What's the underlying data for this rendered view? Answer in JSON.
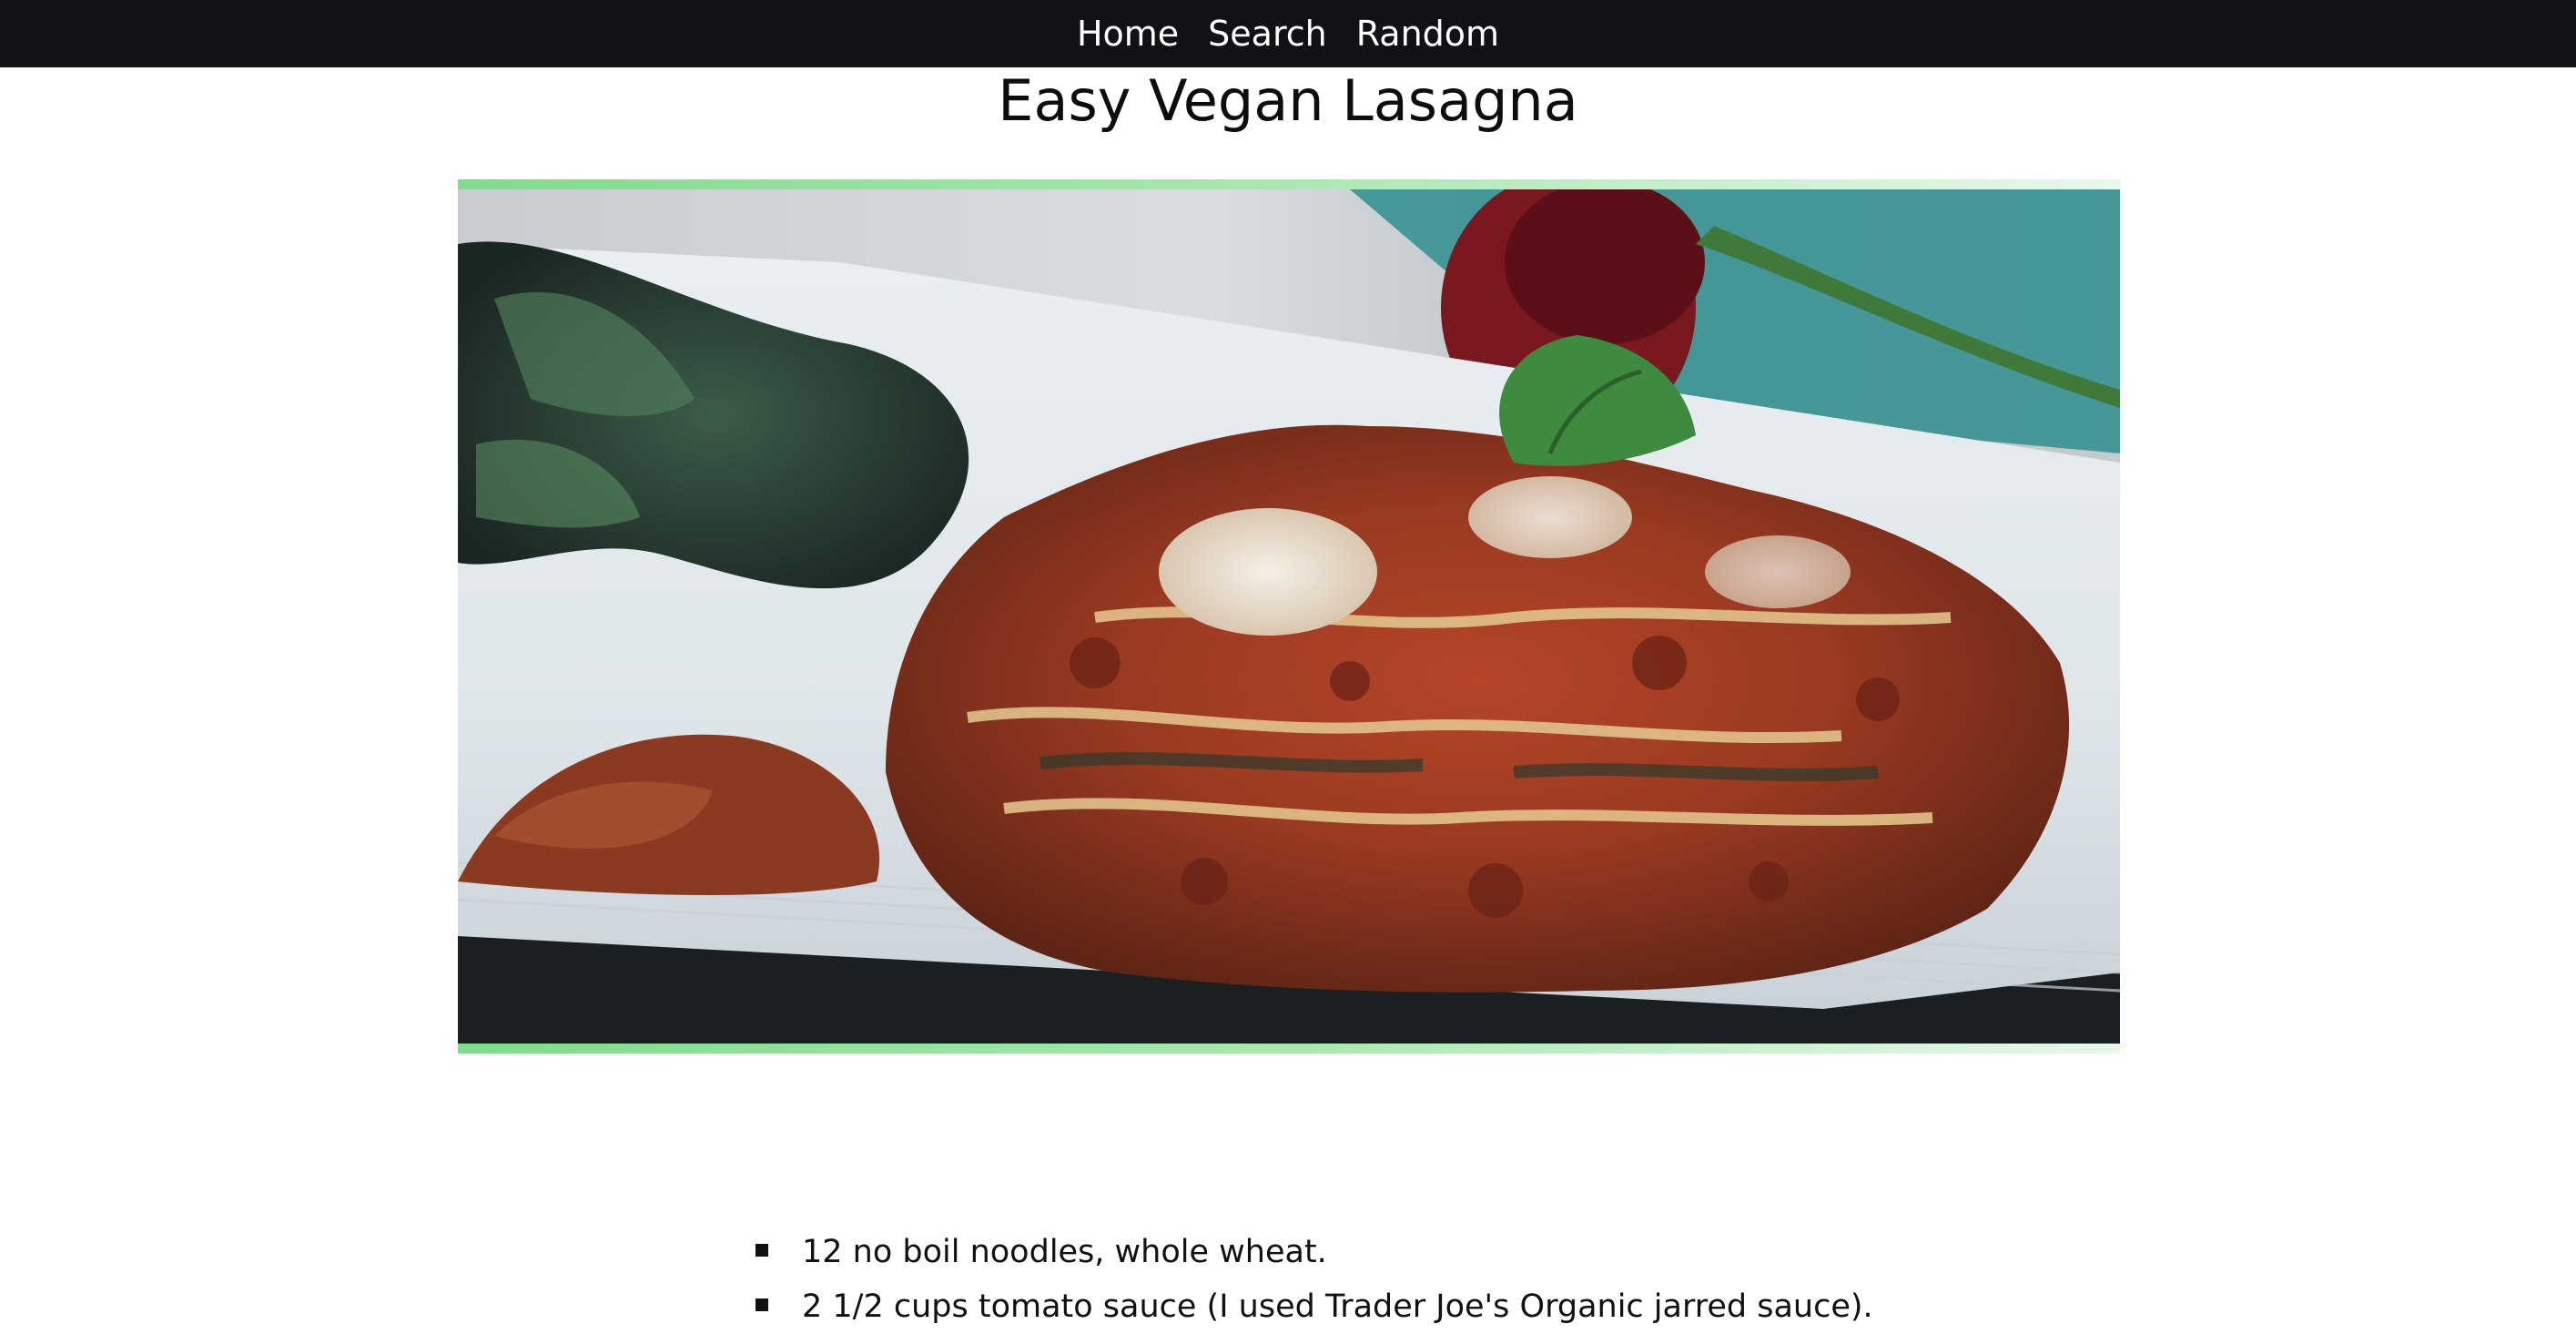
{
  "nav": {
    "links": [
      {
        "label": "Home"
      },
      {
        "label": "Search"
      },
      {
        "label": "Random"
      }
    ],
    "background_color": "#101216",
    "text_color": "#ffffff"
  },
  "recipe": {
    "title": "Easy Vegan Lasagna",
    "image": {
      "subject": "lasagna-photo",
      "frame_accent_color": "#7fdc8c"
    },
    "ingredients": [
      "12 no boil noodles, whole wheat.",
      "2 1/2 cups tomato sauce (I used Trader Joe's Organic jarred sauce)."
    ]
  }
}
